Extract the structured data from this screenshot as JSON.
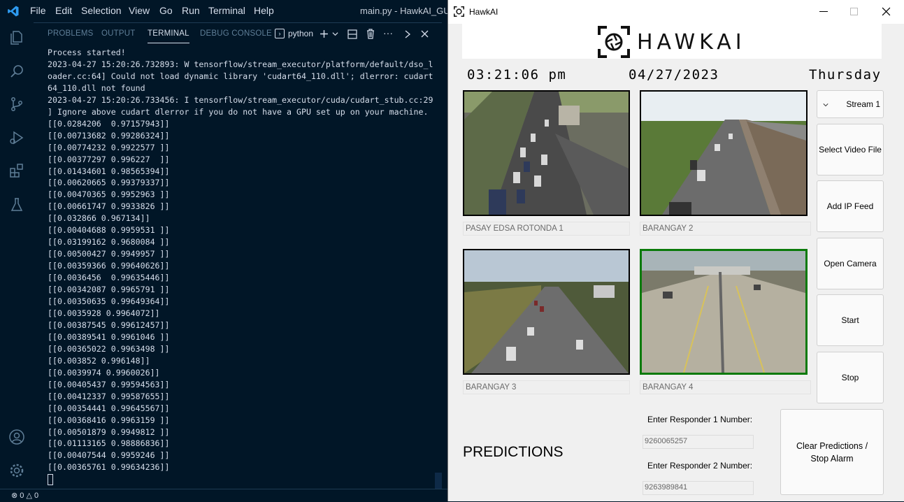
{
  "vscode": {
    "menu": [
      "File",
      "Edit",
      "Selection",
      "View",
      "Go",
      "Run",
      "Terminal",
      "Help"
    ],
    "window_title": "main.py - HawkAI_GUI-",
    "panel_tabs": [
      "PROBLEMS",
      "OUTPUT",
      "TERMINAL",
      "DEBUG CONSOLE"
    ],
    "active_tab": "TERMINAL",
    "terminal_profile": "python",
    "terminal_lines": [
      "Process started!",
      "2023-04-27 15:20:26.732893: W tensorflow/stream_executor/platform/default/dso_l",
      "oader.cc:64] Could not load dynamic library 'cudart64_110.dll'; dlerror: cudart",
      "64_110.dll not found",
      "2023-04-27 15:20:26.733456: I tensorflow/stream_executor/cuda/cudart_stub.cc:29",
      "] Ignore above cudart dlerror if you do not have a GPU set up on your machine.",
      "[[0.0284206  0.97157943]]",
      "[[0.00713682 0.99286324]]",
      "[[0.00774232 0.9922577 ]]",
      "[[0.00377297 0.996227  ]]",
      "[[0.01434601 0.98565394]]",
      "[[0.00620665 0.99379337]]",
      "[[0.00470365 0.9952963 ]]",
      "[[0.00661747 0.9933826 ]]",
      "[[0.032866 0.967134]]",
      "[[0.00404688 0.9959531 ]]",
      "[[0.03199162 0.9680084 ]]",
      "[[0.00500427 0.9949957 ]]",
      "[[0.00359366 0.99640626]]",
      "[[0.0036456  0.99635446]]",
      "[[0.00342087 0.9965791 ]]",
      "[[0.00350635 0.99649364]]",
      "[[0.0035928 0.9964072]]",
      "[[0.00387545 0.99612457]]",
      "[[0.00389541 0.9961046 ]]",
      "[[0.00365022 0.9963498 ]]",
      "[[0.003852 0.996148]]",
      "[[0.0039974 0.9960026]]",
      "[[0.00405437 0.99594563]]",
      "[[0.00412337 0.99587655]]",
      "[[0.00354441 0.99645567]]",
      "[[0.00368416 0.9963159 ]]",
      "[[0.00501879 0.9949812 ]]",
      "[[0.01113165 0.98886836]]",
      "[[0.00407544 0.9959246 ]]",
      "[[0.00365761 0.99634236]]"
    ],
    "status": {
      "errors": "0",
      "warnings": "0"
    }
  },
  "hawkai": {
    "window_title": "HawkAI",
    "logo_text": "HAWKAI",
    "time": "03:21:06 pm",
    "date": "04/27/2023",
    "day": "Thursday",
    "stream_select": "Stream 1",
    "buttons": {
      "select_video": "Select Video File",
      "add_ip": "Add IP Feed",
      "open_camera": "Open Camera",
      "start": "Start",
      "stop": "Stop",
      "clear": "Clear Predictions / Stop Alarm"
    },
    "cameras": [
      {
        "label": "PASAY EDSA ROTONDA 1"
      },
      {
        "label": "BARANGAY 2"
      },
      {
        "label": "BARANGAY 3"
      },
      {
        "label": "BARANGAY 4"
      }
    ],
    "predictions_label": "PREDICTIONS",
    "responder1_label": "Enter Responder 1 Number:",
    "responder1_value": "9260065257",
    "responder2_label": "Enter Responder 2 Number:",
    "responder2_value": "9263989841"
  },
  "colors": {
    "vscode_bg": "#011627",
    "active_feed_border": "#0a7a0a"
  }
}
